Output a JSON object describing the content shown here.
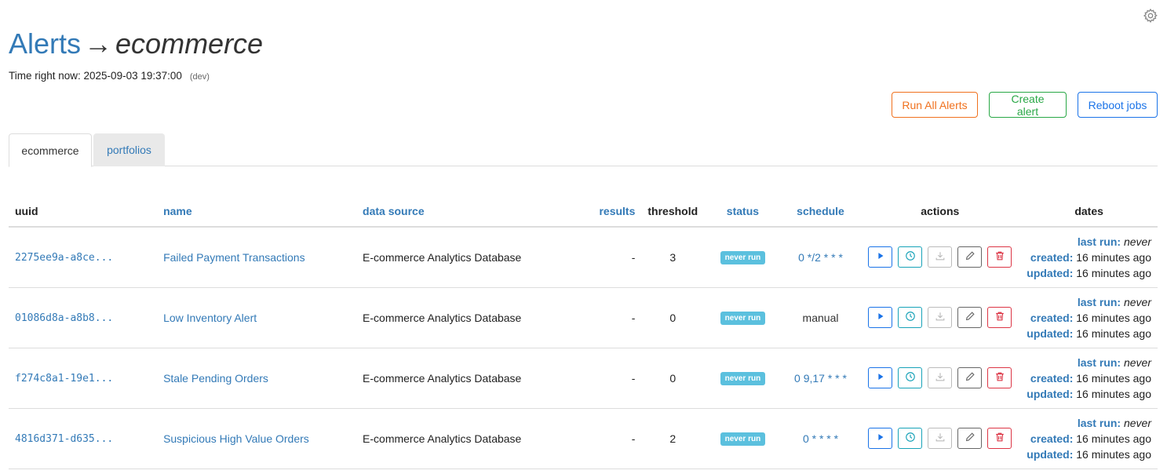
{
  "header": {
    "title": "Alerts",
    "arrow": "→",
    "subtitle": "ecommerce",
    "time_label": "Time right now: 2025-09-03 19:37:00",
    "env": "(dev)"
  },
  "toolbar": {
    "run_all": "Run All Alerts",
    "create": "Create alert",
    "reboot": "Reboot jobs"
  },
  "tabs": [
    "ecommerce",
    "portfolios"
  ],
  "table": {
    "columns": [
      "uuid",
      "name",
      "data source",
      "results",
      "threshold",
      "status",
      "schedule",
      "actions",
      "dates"
    ],
    "date_labels": {
      "last_run": "last run:",
      "created": "created:",
      "updated": "updated:"
    },
    "rows": [
      {
        "uuid": "2275ee9a-a8ce...",
        "name": "Failed Payment Transactions",
        "source": "E-commerce Analytics Database",
        "results": "-",
        "threshold": "3",
        "status": "never run",
        "schedule": "0 */2 * * *",
        "last_run": "never",
        "created": "16 minutes ago",
        "updated": "16 minutes ago"
      },
      {
        "uuid": "01086d8a-a8b8...",
        "name": "Low Inventory Alert",
        "source": "E-commerce Analytics Database",
        "results": "-",
        "threshold": "0",
        "status": "never run",
        "schedule": "manual",
        "last_run": "never",
        "created": "16 minutes ago",
        "updated": "16 minutes ago"
      },
      {
        "uuid": "f274c8a1-19e1...",
        "name": "Stale Pending Orders",
        "source": "E-commerce Analytics Database",
        "results": "-",
        "threshold": "0",
        "status": "never run",
        "schedule": "0 9,17 * * *",
        "last_run": "never",
        "created": "16 minutes ago",
        "updated": "16 minutes ago"
      },
      {
        "uuid": "4816d371-d635...",
        "name": "Suspicious High Value Orders",
        "source": "E-commerce Analytics Database",
        "results": "-",
        "threshold": "2",
        "status": "never run",
        "schedule": "0 * * * *",
        "last_run": "never",
        "created": "16 minutes ago",
        "updated": "16 minutes ago"
      }
    ]
  },
  "icons": {
    "settings": "gear-icon",
    "run": "play-icon",
    "schedule": "clock-icon",
    "download": "download-icon",
    "edit": "pencil-icon",
    "delete": "trash-icon"
  },
  "colors": {
    "link": "#337ab7",
    "run_all": "#f0711e",
    "create": "#28a745",
    "reboot": "#1a73e8",
    "badge": "#5bc0de",
    "delete": "#dc3545"
  }
}
